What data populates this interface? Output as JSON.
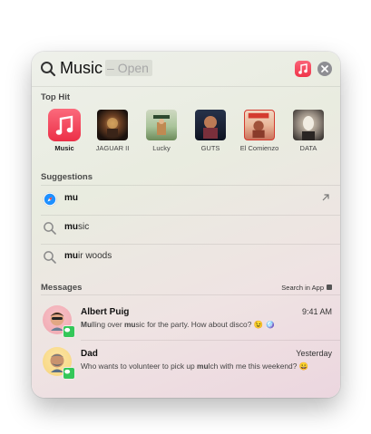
{
  "search": {
    "query_prefix": "Mus",
    "query_rest": "ic",
    "hint": "– Open"
  },
  "sections": {
    "top_hit": "Top Hit",
    "suggestions": "Suggestions",
    "messages": "Messages",
    "search_in_app": "Search in App"
  },
  "top_hits": [
    {
      "label": "Music",
      "icon": "music-app-icon",
      "bold": true
    },
    {
      "label": "JAGUAR II",
      "icon": "album-art"
    },
    {
      "label": "Lucky",
      "icon": "album-art"
    },
    {
      "label": "GUTS",
      "icon": "album-art"
    },
    {
      "label": "El Comienzo",
      "icon": "album-art"
    },
    {
      "label": "DATA",
      "icon": "album-art"
    }
  ],
  "suggestions": [
    {
      "match": "mu",
      "rest": "",
      "icon": "safari-icon"
    },
    {
      "match": "mu",
      "rest": "sic",
      "icon": "search-icon"
    },
    {
      "match": "mu",
      "rest": "ir woods",
      "icon": "search-icon"
    }
  ],
  "messages": [
    {
      "sender": "Albert Puig",
      "time": "9:41 AM",
      "preview_parts": [
        "Mu",
        "lling over ",
        "mu",
        "sic for the party. How about disco? 😉 🪩"
      ]
    },
    {
      "sender": "Dad",
      "time": "Yesterday",
      "preview_parts": [
        "Who wants to volunteer to pick up ",
        "mu",
        "lch with me this weekend? 😀",
        ""
      ]
    }
  ],
  "colors": {
    "music_red": "#f0354a",
    "messages_green": "#34c759",
    "safari_blue": "#1e90ff"
  }
}
